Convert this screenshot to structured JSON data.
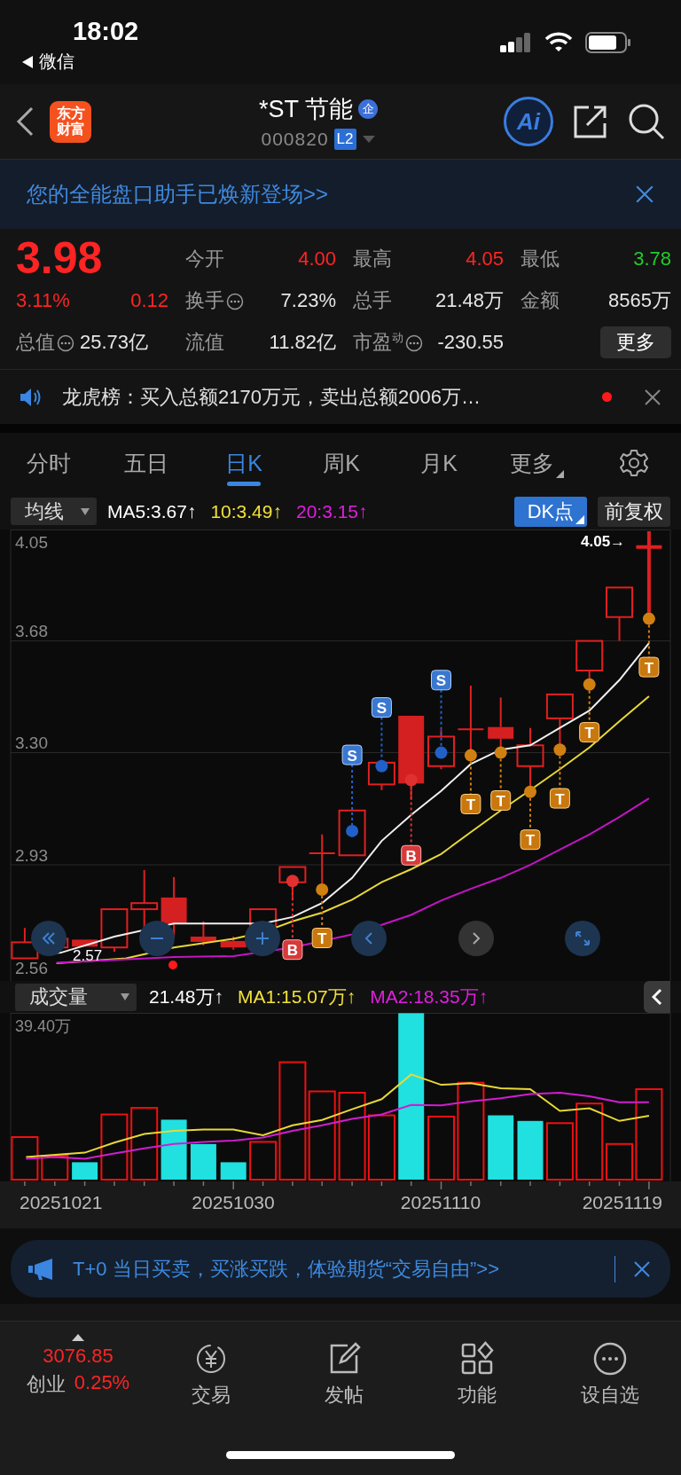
{
  "status_bar": {
    "time": "18:02",
    "back_app": "微信"
  },
  "header": {
    "logo": [
      "东方",
      "财富"
    ],
    "title": "*ST 节能",
    "badge": "企",
    "code": "000820",
    "level_badge": "L2",
    "ai_button": "Ai"
  },
  "banner": {
    "text": "您的全能盘口助手已焕新登场>>"
  },
  "quote": {
    "price": "3.98",
    "change_pct": "3.11%",
    "change": "0.12",
    "color": "#ff2424",
    "market_cap": {
      "label": "总值",
      "info": true,
      "value": "25.73亿"
    },
    "stats": [
      {
        "label": "今开",
        "info": false,
        "value": "4.00",
        "color": "#ff2424"
      },
      {
        "label": "最高",
        "info": false,
        "value": "4.05",
        "color": "#ff2424"
      },
      {
        "label": "最低",
        "info": false,
        "value": "3.78",
        "color": "#22cc2a"
      },
      {
        "label": "换手",
        "info": true,
        "value": "7.23%",
        "color": "#e6e6e6"
      },
      {
        "label": "总手",
        "info": false,
        "value": "21.48万",
        "color": "#e6e6e6"
      },
      {
        "label": "金额",
        "info": false,
        "value": "8565万",
        "color": "#e6e6e6"
      },
      {
        "label": "流值",
        "info": false,
        "value": "11.82亿",
        "color": "#e6e6e6"
      },
      {
        "label": "市盈$^{动}$",
        "info": true,
        "value": "-230.55",
        "color": "#e6e6e6"
      }
    ],
    "more_button": "更多"
  },
  "news": {
    "text": "龙虎榜：买入总额2170万元，卖出总额2006万…",
    "unread": true
  },
  "tabs": [
    {
      "label": "分时",
      "kind": "plain",
      "selected": false
    },
    {
      "label": "五日",
      "kind": "plain",
      "selected": false
    },
    {
      "label": "日K",
      "kind": "plain",
      "selected": true
    },
    {
      "label": "周K",
      "kind": "plain",
      "selected": false
    },
    {
      "label": "月K",
      "kind": "plain",
      "selected": false
    },
    {
      "label": "更多",
      "kind": "menu",
      "selected": false
    }
  ],
  "ma_row": {
    "selector": "均线",
    "values": [
      {
        "text": "MA5:3.67↑",
        "color": "#ffffff"
      },
      {
        "text": "10:3.49↑",
        "color": "#f2e13a"
      },
      {
        "text": "20:3.15↑",
        "color": "#e01ee0"
      }
    ],
    "buttons": [
      {
        "label": "DK点",
        "selected": true
      },
      {
        "label": "前复权",
        "selected": false
      }
    ]
  },
  "kline": {
    "y_labels": [
      "4.05",
      "3.68",
      "3.30",
      "2.93",
      "2.56"
    ],
    "high_label": "4.05→",
    "low_label": "2.57",
    "signals": [
      {
        "label": "B",
        "kind": "buy"
      },
      {
        "label": "T",
        "kind": "trade"
      },
      {
        "label": "S",
        "kind": "sell"
      },
      {
        "label": "S",
        "kind": "sell"
      },
      {
        "label": "B",
        "kind": "buy"
      },
      {
        "label": "S",
        "kind": "sell"
      },
      {
        "label": "T",
        "kind": "trade"
      },
      {
        "label": "T",
        "kind": "trade"
      },
      {
        "label": "T",
        "kind": "trade"
      },
      {
        "label": "T",
        "kind": "trade"
      },
      {
        "label": "T",
        "kind": "trade"
      },
      {
        "label": "T",
        "kind": "trade"
      }
    ]
  },
  "volume": {
    "selector": "成交量",
    "values": [
      {
        "text": "21.48万↑",
        "color": "#ffffff"
      },
      {
        "text": "MA1:15.07万↑",
        "color": "#f2e13a"
      },
      {
        "text": "MA2:18.35万↑",
        "color": "#e01ee0"
      }
    ],
    "max_label": "39.40万",
    "dates": [
      "20251021",
      "20251030",
      "20251110",
      "20251119"
    ]
  },
  "ad": {
    "text": "T+0 当日买卖，买涨买跌，体验期货“交易自由”>>"
  },
  "bottom_nav": {
    "index": {
      "value": "3076.85",
      "name": "创业",
      "change": "0.25%",
      "color": "#ff2424"
    },
    "items": [
      {
        "label": "交易",
        "kind": "trade"
      },
      {
        "label": "发帖",
        "kind": "post"
      },
      {
        "label": "功能",
        "kind": "apps"
      },
      {
        "label": "设自选",
        "kind": "watch"
      }
    ]
  }
}
